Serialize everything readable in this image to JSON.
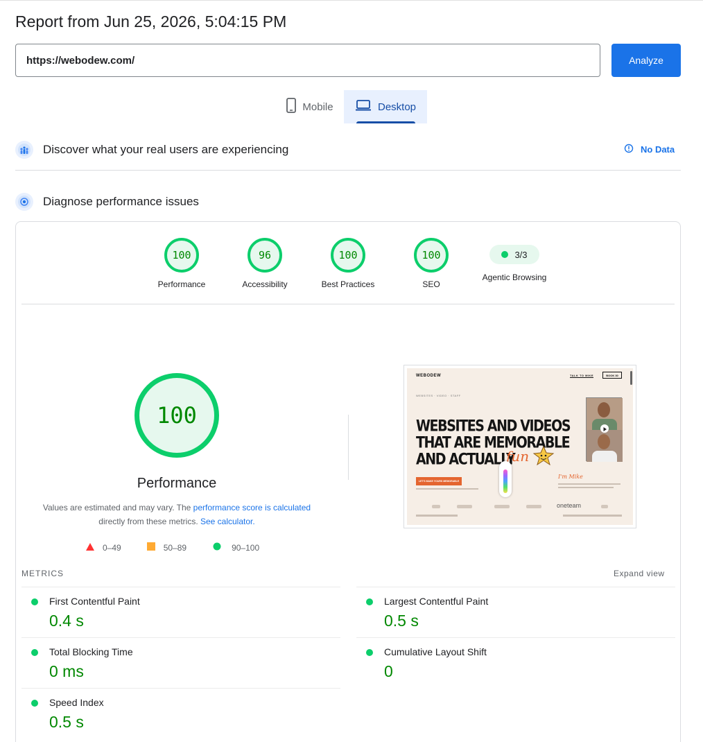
{
  "report": {
    "title": "Report from Jun 25, 2026, 5:04:15 PM"
  },
  "search": {
    "url": "https://webodew.com/",
    "analyze_label": "Analyze"
  },
  "tabs": [
    {
      "label": "Mobile",
      "icon": "phone-icon"
    },
    {
      "label": "Desktop",
      "icon": "laptop-icon",
      "selected": true
    }
  ],
  "field_data": {
    "title": "Discover what your real users are experiencing",
    "status": "No Data"
  },
  "lab_data": {
    "title": "Diagnose performance issues"
  },
  "scores": [
    {
      "label": "Performance",
      "value": "100"
    },
    {
      "label": "Accessibility",
      "value": "96"
    },
    {
      "label": "Best Practices",
      "value": "100"
    },
    {
      "label": "SEO",
      "value": "100"
    }
  ],
  "agentic": {
    "label": "Agentic Browsing",
    "value": "3/3"
  },
  "main_gauge": {
    "value": "100",
    "label": "Performance",
    "desc_1": "Values are estimated and may vary. The ",
    "link_1": "performance score is calculated",
    "desc_2": " directly from these metrics. ",
    "link_2": "See calculator."
  },
  "legend": [
    {
      "range": "0–49",
      "color": "#ff3333"
    },
    {
      "range": "50–89",
      "color": "#ffaa33"
    },
    {
      "range": "90–100",
      "color": "#0cce6b"
    }
  ],
  "screenshot": {
    "brand": "WEBODEW",
    "cta_small": "TALK TO MIKE",
    "cta_box": "BOOK 30",
    "nav": "WEBSITES · VIDEO · STAFF",
    "headline_1": "WEBSITES AND VIDEOS",
    "headline_2": "THAT ARE MEMORABLE",
    "headline_3": "AND ACTUALLY",
    "headline_fun": "fun",
    "button": "LET'S MAKE YOURS MEMORABLE",
    "signature": "I'm Mike",
    "logo_oneteam": "oneteam"
  },
  "metrics": {
    "heading": "METRICS",
    "expand_label": "Expand view",
    "items": [
      {
        "name": "First Contentful Paint",
        "value": "0.4 s"
      },
      {
        "name": "Largest Contentful Paint",
        "value": "0.5 s"
      },
      {
        "name": "Total Blocking Time",
        "value": "0 ms"
      },
      {
        "name": "Cumulative Layout Shift",
        "value": "0"
      },
      {
        "name": "Speed Index",
        "value": "0.5 s"
      }
    ]
  },
  "colors": {
    "accent": "#1a73e8",
    "pass": "#0cce6b",
    "pass_text": "#008800"
  }
}
